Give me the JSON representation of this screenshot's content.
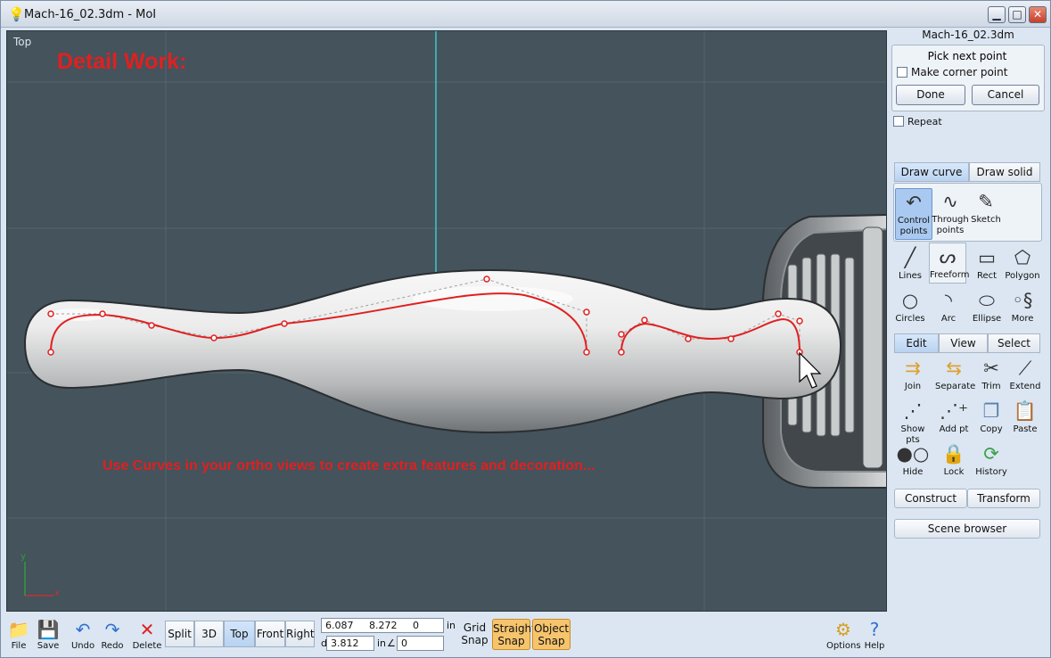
{
  "window": {
    "title": "Mach-16_02.3dm - MoI"
  },
  "viewport": {
    "label": "Top",
    "heading": "Detail Work:",
    "caption": "Use Curves in your ortho views to create extra features and decoration...",
    "axis_x": "x",
    "axis_y": "y"
  },
  "side": {
    "doc_name": "Mach-16_02.3dm",
    "prompt": "Pick next point",
    "corner_label": "Make corner point",
    "done": "Done",
    "cancel": "Cancel",
    "repeat": "Repeat",
    "draw_tabs": [
      "Draw curve",
      "Draw solid"
    ],
    "curve_tools": [
      {
        "label": "Control points",
        "icon": "control-points-icon"
      },
      {
        "label": "Through points",
        "icon": "through-points-icon"
      },
      {
        "label": "Sketch",
        "icon": "sketch-icon"
      }
    ],
    "shape_tools": [
      {
        "label": "Lines",
        "icon": "line-icon"
      },
      {
        "label": "Freeform",
        "icon": "freeform-icon"
      },
      {
        "label": "Rect",
        "icon": "rect-icon"
      },
      {
        "label": "Polygon",
        "icon": "polygon-icon"
      },
      {
        "label": "Circles",
        "icon": "circle-icon"
      },
      {
        "label": "Arc",
        "icon": "arc-icon"
      },
      {
        "label": "Ellipse",
        "icon": "ellipse-icon"
      },
      {
        "label": "More",
        "icon": "more-icon"
      }
    ],
    "edit_tabs": [
      "Edit",
      "View",
      "Select"
    ],
    "edit_tools": [
      {
        "label": "Join",
        "icon": "join-icon"
      },
      {
        "label": "Separate",
        "icon": "separate-icon"
      },
      {
        "label": "Trim",
        "icon": "trim-icon"
      },
      {
        "label": "Extend",
        "icon": "extend-icon"
      },
      {
        "label": "Show pts",
        "icon": "show-points-icon"
      },
      {
        "label": "Add pt",
        "icon": "add-point-icon"
      },
      {
        "label": "Copy",
        "icon": "copy-icon"
      },
      {
        "label": "Paste",
        "icon": "paste-icon"
      },
      {
        "label": "Hide",
        "icon": "hide-icon"
      },
      {
        "label": "Lock",
        "icon": "lock-icon"
      },
      {
        "label": "History",
        "icon": "history-icon"
      }
    ],
    "construct": "Construct",
    "transform": "Transform",
    "scene_browser": "Scene browser"
  },
  "bottom": {
    "file": "File",
    "save": "Save",
    "undo": "Undo",
    "redo": "Redo",
    "delete": "Delete",
    "views": [
      "Split",
      "3D",
      "Top",
      "Front",
      "Right"
    ],
    "active_view": "Top",
    "coord_x": "6.087",
    "coord_y": "8.272",
    "coord_z": "0",
    "unit": "in",
    "d_label": "d",
    "distance": "3.812",
    "unit2": "in",
    "angle_symbol": "∠",
    "angle": "0",
    "grid_snap_1": "Grid",
    "grid_snap_2": "Snap",
    "straight_snap_1": "Straight",
    "straight_snap_2": "Snap",
    "object_snap_1": "Object",
    "object_snap_2": "Snap",
    "options": "Options",
    "help": "Help"
  },
  "colors": {
    "accent": "#f5c46d",
    "curve": "#e02020",
    "viewport_bg": "#44535c"
  }
}
